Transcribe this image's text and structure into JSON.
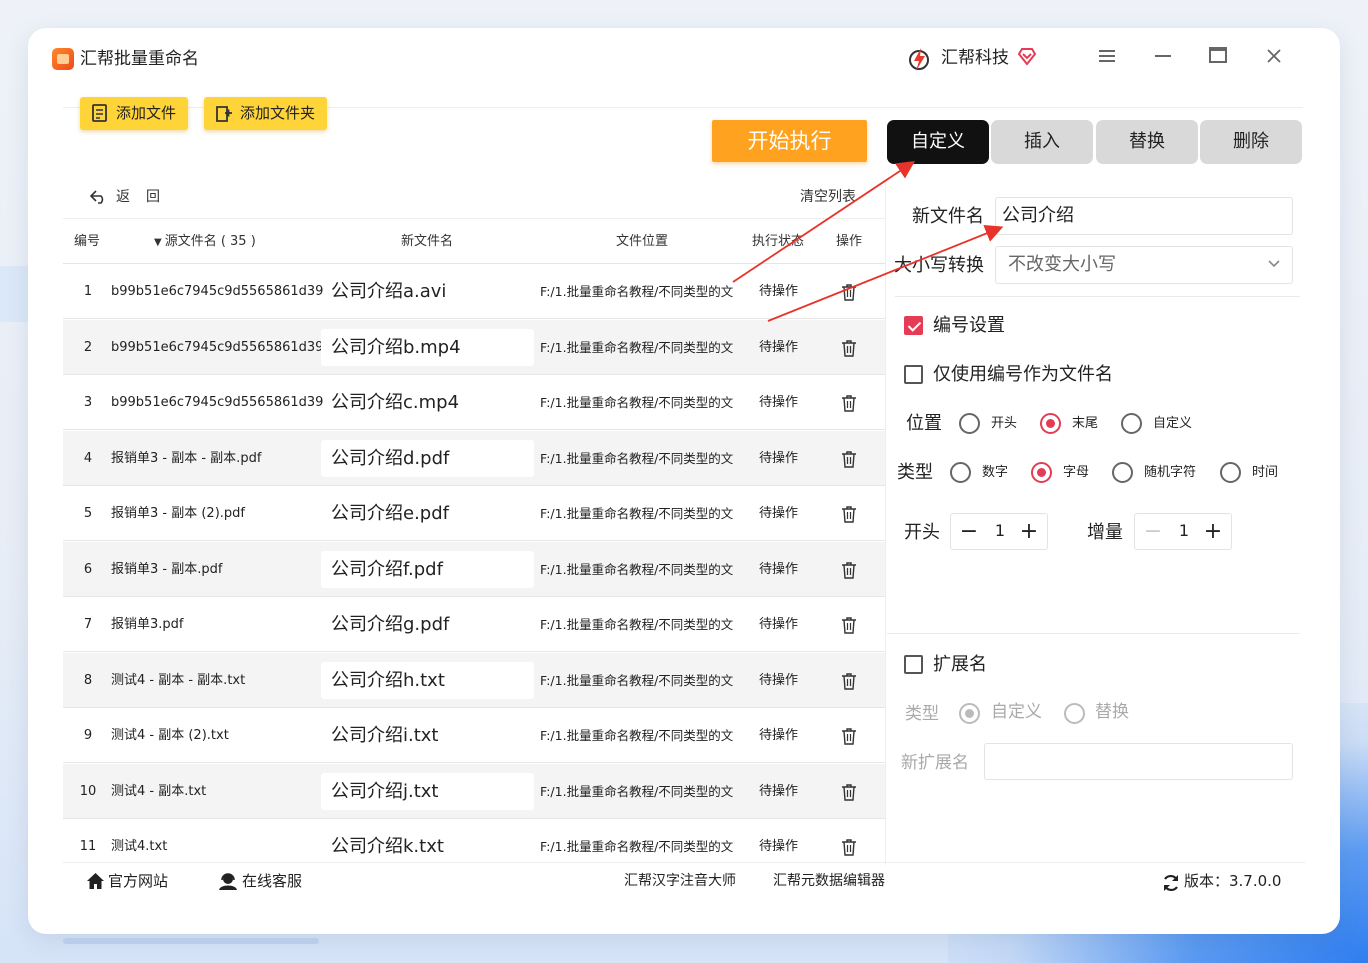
{
  "app": {
    "title": "汇帮批量重命名",
    "brand": "汇帮科技"
  },
  "toolbar": {
    "add_file": "添加文件",
    "add_folder": "添加文件夹",
    "start": "开始执行",
    "back": "返",
    "back2": "回",
    "clear_list": "清空列表"
  },
  "table": {
    "headers": {
      "num": "编号",
      "source": "源文件名 ( 35 )",
      "new_name": "新文件名",
      "location": "文件位置",
      "status": "执行状态",
      "action": "操作"
    },
    "rows": [
      {
        "num": "1",
        "source": "b99b51e6c7945c9d5565861d39",
        "new": "公司介绍a.avi",
        "path": "F:/1.批量重命名教程/不同类型的文",
        "status": "待操作"
      },
      {
        "num": "2",
        "source": "b99b51e6c7945c9d5565861d39",
        "new": "公司介绍b.mp4",
        "path": "F:/1.批量重命名教程/不同类型的文",
        "status": "待操作"
      },
      {
        "num": "3",
        "source": "b99b51e6c7945c9d5565861d39",
        "new": "公司介绍c.mp4",
        "path": "F:/1.批量重命名教程/不同类型的文",
        "status": "待操作"
      },
      {
        "num": "4",
        "source": "报销单3 - 副本 - 副本.pdf",
        "new": "公司介绍d.pdf",
        "path": "F:/1.批量重命名教程/不同类型的文",
        "status": "待操作"
      },
      {
        "num": "5",
        "source": "报销单3 - 副本 (2).pdf",
        "new": "公司介绍e.pdf",
        "path": "F:/1.批量重命名教程/不同类型的文",
        "status": "待操作"
      },
      {
        "num": "6",
        "source": "报销单3 - 副本.pdf",
        "new": "公司介绍f.pdf",
        "path": "F:/1.批量重命名教程/不同类型的文",
        "status": "待操作"
      },
      {
        "num": "7",
        "source": "报销单3.pdf",
        "new": "公司介绍g.pdf",
        "path": "F:/1.批量重命名教程/不同类型的文",
        "status": "待操作"
      },
      {
        "num": "8",
        "source": "测试4 - 副本 - 副本.txt",
        "new": "公司介绍h.txt",
        "path": "F:/1.批量重命名教程/不同类型的文",
        "status": "待操作"
      },
      {
        "num": "9",
        "source": "测试4 - 副本 (2).txt",
        "new": "公司介绍i.txt",
        "path": "F:/1.批量重命名教程/不同类型的文",
        "status": "待操作"
      },
      {
        "num": "10",
        "source": "测试4 - 副本.txt",
        "new": "公司介绍j.txt",
        "path": "F:/1.批量重命名教程/不同类型的文",
        "status": "待操作"
      },
      {
        "num": "11",
        "source": "测试4.txt",
        "new": "公司介绍k.txt",
        "path": "F:/1.批量重命名教程/不同类型的文",
        "status": "待操作"
      }
    ]
  },
  "tabs": {
    "custom": "自定义",
    "insert": "插入",
    "replace": "替换",
    "delete": "删除",
    "active": "自定义"
  },
  "panel": {
    "new_name_label": "新文件名",
    "new_name_value": "公司介绍",
    "case_label": "大小写转换",
    "case_value": "不改变大小写",
    "numbering_label": "编号设置",
    "numbering_checked": true,
    "only_number_label": "仅使用编号作为文件名",
    "only_number_checked": false,
    "position_label": "位置",
    "position_options": [
      "开头",
      "末尾",
      "自定义"
    ],
    "position_selected": "末尾",
    "type_label": "类型",
    "type_options": [
      "数字",
      "字母",
      "随机字符",
      "时间"
    ],
    "type_selected": "字母",
    "start_label": "开头",
    "start_value": "1",
    "increment_label": "增量",
    "increment_value": "1",
    "ext_label": "扩展名",
    "ext_checked": false,
    "ext_type_label": "类型",
    "ext_type_options": [
      "自定义",
      "替换"
    ],
    "ext_type_selected": "自定义",
    "new_ext_label": "新扩展名",
    "new_ext_value": ""
  },
  "footer": {
    "website": "官方网站",
    "support": "在线客服",
    "link1": "汇帮汉字注音大师",
    "link2": "汇帮元数据编辑器",
    "version": "版本：3.7.0.0"
  },
  "colors": {
    "accent": "#e63b55",
    "start": "#ffa21f",
    "yellow": "#ffd438",
    "tab_active": "#111111"
  }
}
